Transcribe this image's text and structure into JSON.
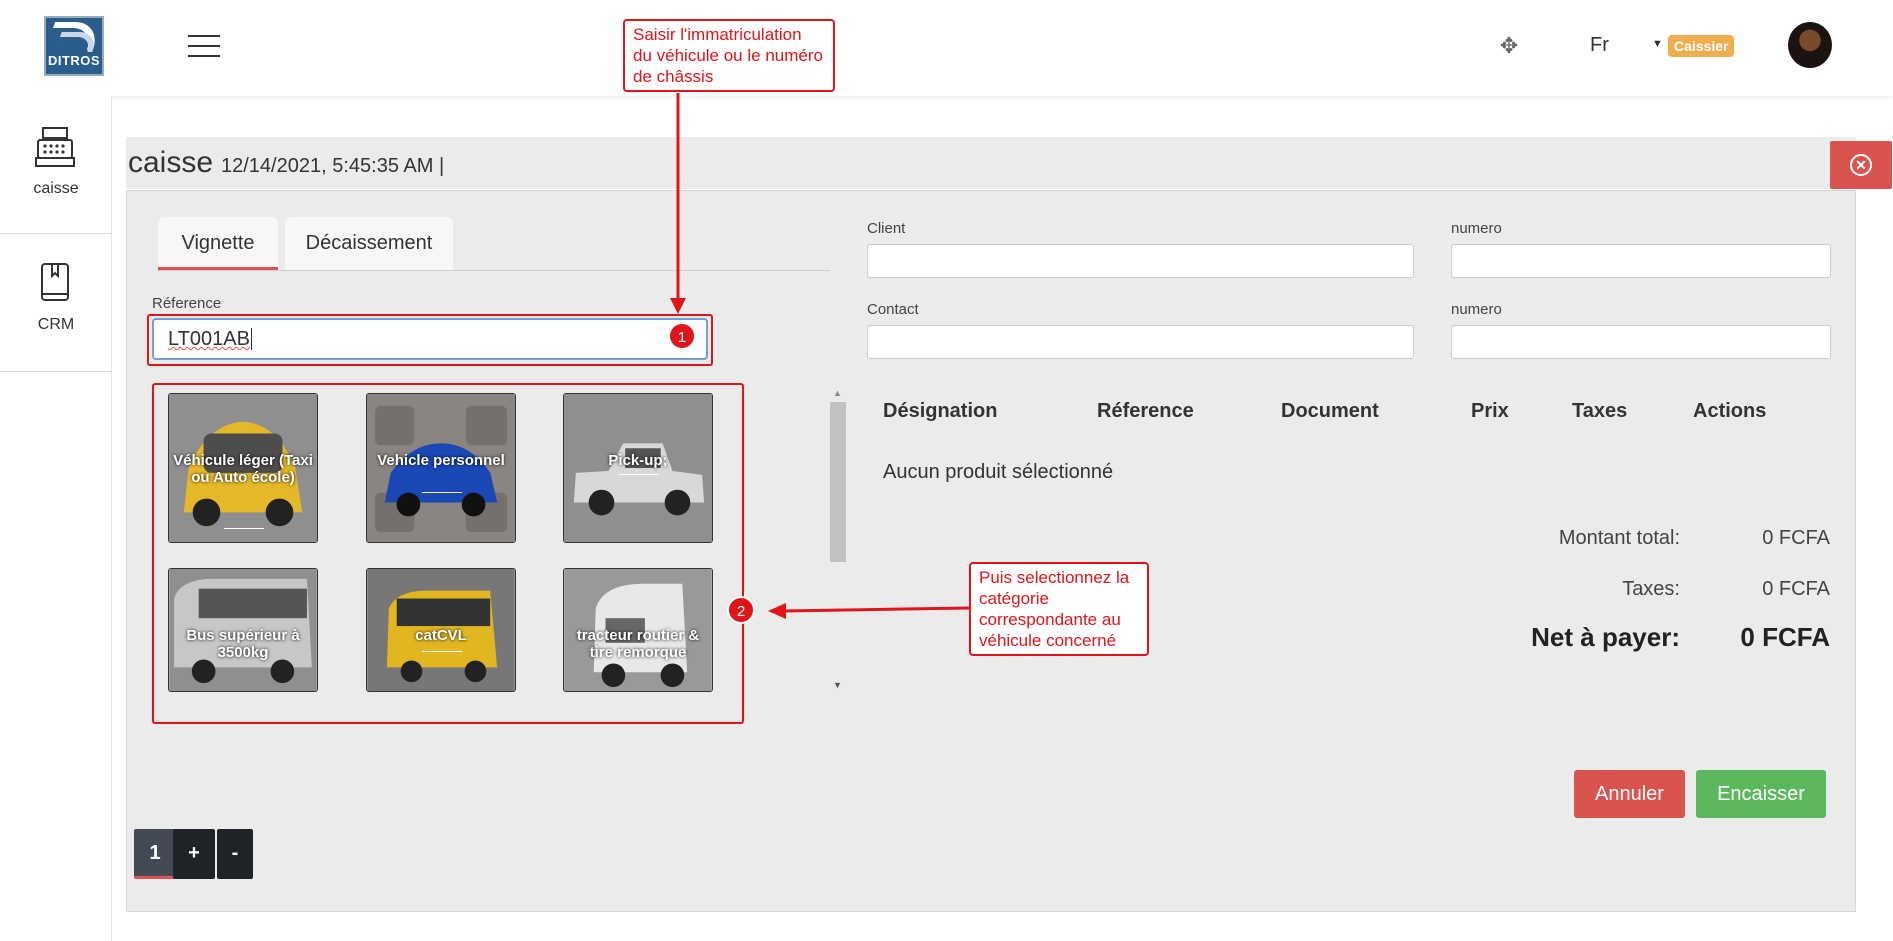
{
  "header": {
    "logo_text": "DITROS",
    "language": "Fr",
    "role_badge": "Caissier",
    "move_icon_glyph": "✥"
  },
  "sidebar": {
    "items": [
      {
        "label": "caisse",
        "icon": "cash-register-icon"
      },
      {
        "label": "CRM",
        "icon": "book-icon"
      }
    ]
  },
  "main": {
    "title": "caisse",
    "datetime": "12/14/2021, 5:45:35 AM |",
    "close_glyph": "✕"
  },
  "tabs": [
    {
      "label": "Vignette",
      "active": true
    },
    {
      "label": "Décaissement",
      "active": false
    }
  ],
  "reference": {
    "label": "Réference",
    "value": "LT001AB"
  },
  "tiles": [
    {
      "label": "Véhicule léger (Taxi ou Auto école)"
    },
    {
      "label": "Vehicle personnel"
    },
    {
      "label": "Pick-up;"
    },
    {
      "label": "Bus supérieur à 3500kg"
    },
    {
      "label": "catCVL"
    },
    {
      "label": "tracteur routier & tire remorque"
    }
  ],
  "client_form": {
    "client_label": "Client",
    "numero_label_1": "numero",
    "contact_label": "Contact",
    "numero_label_2": "numero"
  },
  "table": {
    "headers": [
      "Désignation",
      "Réference",
      "Document",
      "Prix",
      "Taxes",
      "Actions"
    ],
    "empty_message": "Aucun produit sélectionné"
  },
  "totals": {
    "total_label": "Montant total:",
    "total_value": "0 FCFA",
    "taxes_label": "Taxes:",
    "taxes_value": "0 FCFA",
    "net_label": "Net à payer:",
    "net_value": "0 FCFA"
  },
  "actions": {
    "cancel_label": "Annuler",
    "cash_label": "Encaisser"
  },
  "pager": {
    "page": "1",
    "plus": "+",
    "minus": "-"
  },
  "annotations": {
    "note1": "Saisir l'immatriculation du véhicule ou le numéro de châssis",
    "note2": "Puis selectionnez la catégorie correspondante au véhicule concerné",
    "badge1": "1",
    "badge2": "2"
  },
  "colors": {
    "danger": "#d9534f",
    "success": "#5cb85c",
    "warning": "#f0ad4e",
    "annotation_red": "#e0151a"
  }
}
